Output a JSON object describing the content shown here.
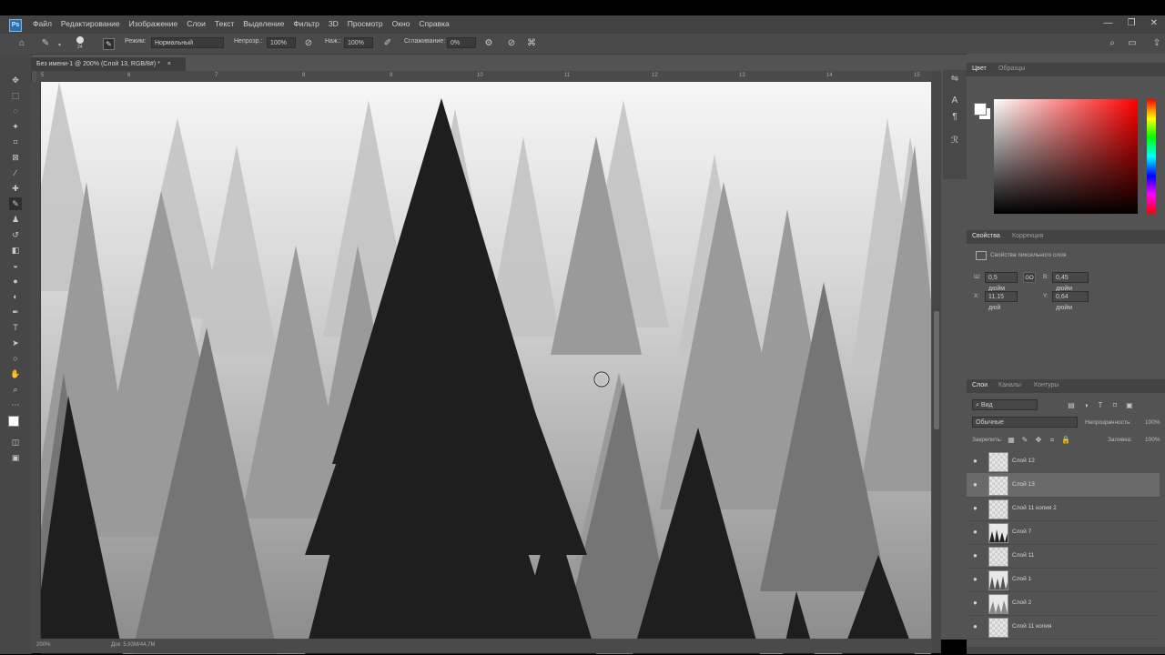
{
  "app": {
    "logo": "Ps",
    "menu": [
      "Файл",
      "Редактирование",
      "Изображение",
      "Слои",
      "Текст",
      "Выделение",
      "Фильтр",
      "3D",
      "Просмотр",
      "Окно",
      "Справка"
    ],
    "window_controls": [
      "—",
      "❐",
      "✕"
    ]
  },
  "options": {
    "brush_size": "24",
    "mode_label": "Режим:",
    "mode_value": "Нормальный",
    "opacity_label": "Непрозр.:",
    "opacity_value": "100%",
    "flow_label": "Наж.:",
    "flow_value": "100%",
    "smoothing_label": "Сглаживание:",
    "smoothing_value": "0%"
  },
  "document": {
    "tab_title": "Без имени-1 @ 200% (Слой 13, RGB/8#) *",
    "close": "×",
    "ruler_ticks": [
      "5",
      "6",
      "7",
      "8",
      "9",
      "10",
      "11",
      "12",
      "13",
      "14",
      "15"
    ]
  },
  "status": {
    "zoom": "200%",
    "doc_info": "Док: 5,93М/44,7М"
  },
  "color_panel": {
    "tabs": [
      "Цвет",
      "Образцы"
    ],
    "active": 0
  },
  "properties_panel": {
    "tabs": [
      "Свойства",
      "Коррекция"
    ],
    "title": "Свойства пиксельного слоя",
    "w_label": "Ш:",
    "w_value": "0,5 дюйм",
    "link": "GO",
    "h_label": "В:",
    "h_value": "0,45 дюйм",
    "x_label": "X:",
    "x_value": "11,15 дюй",
    "y_label": "Y:",
    "y_value": "0,64 дюйм"
  },
  "layers_panel": {
    "tabs": [
      "Слои",
      "Каналы",
      "Контуры"
    ],
    "filter_label": "Вид",
    "blend_mode": "Обычные",
    "opacity_label": "Непрозрачность:",
    "opacity_value": "100%",
    "lock_label": "Закрепить:",
    "fill_label": "Заливка:",
    "fill_value": "100%",
    "layers": [
      {
        "name": "Слой 12",
        "selected": false,
        "thumb": "empty"
      },
      {
        "name": "Слой 13",
        "selected": true,
        "thumb": "empty"
      },
      {
        "name": "Слой 11 копия 2",
        "selected": false,
        "thumb": "empty"
      },
      {
        "name": "Слой 7",
        "selected": false,
        "thumb": "trees-dark"
      },
      {
        "name": "Слой 11",
        "selected": false,
        "thumb": "empty"
      },
      {
        "name": "Слой 1",
        "selected": false,
        "thumb": "trees-light"
      },
      {
        "name": "Слой 2",
        "selected": false,
        "thumb": "trees-light"
      },
      {
        "name": "Слой 11 копия",
        "selected": false,
        "thumb": "empty"
      }
    ]
  },
  "icons": {
    "home": "⌂",
    "brush": "✎",
    "search": "⌕",
    "eye": "●",
    "gear": "⚙"
  }
}
